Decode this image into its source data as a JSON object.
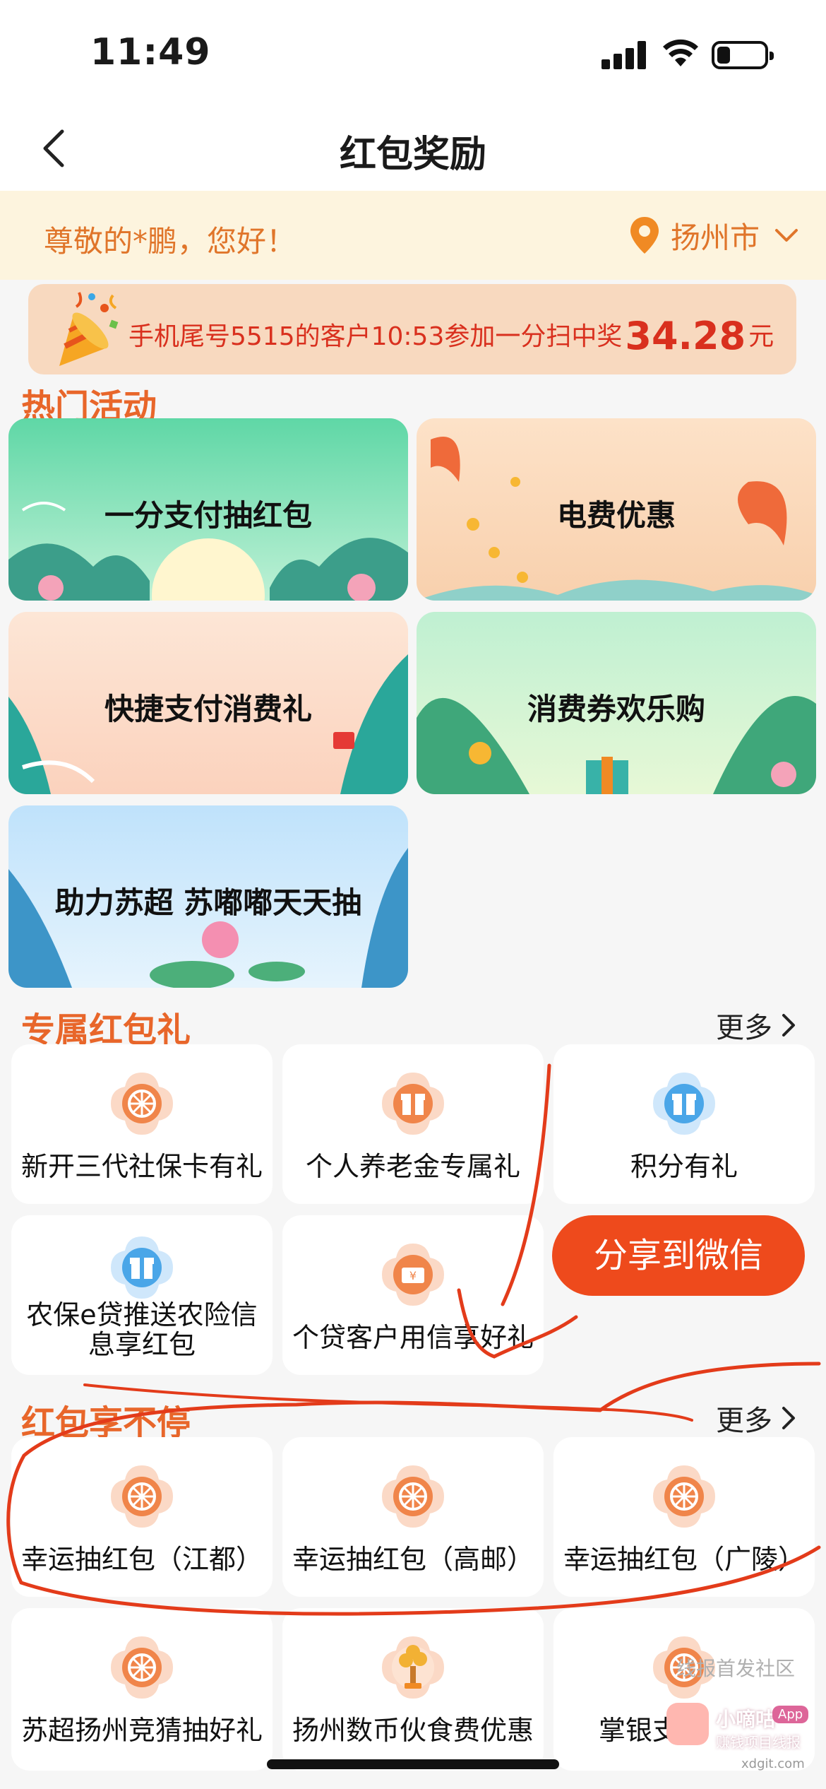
{
  "status_bar": {
    "time": "11:49"
  },
  "nav": {
    "title": "红包奖励"
  },
  "greeting": {
    "text": "尊敬的*鹏，您好！",
    "city": "扬州市"
  },
  "notice": {
    "text": "手机尾号5515的客户10:53参加一分扫中奖",
    "amount": "34.28",
    "unit": "元"
  },
  "hot_section": {
    "title": "热门活动",
    "items": [
      {
        "label": "一分支付抽红包"
      },
      {
        "label": "电费优惠"
      },
      {
        "label": "快捷支付消费礼"
      },
      {
        "label": "消费券欢乐购"
      },
      {
        "label": "助力苏超 苏嘟嘟天天抽"
      }
    ]
  },
  "exclusive_section": {
    "title": "专属红包礼",
    "more": "更多",
    "items": [
      {
        "label": "新开三代社保卡有礼",
        "icon": "gift-wheel-icon"
      },
      {
        "label": "个人养老金专属礼",
        "icon": "gift-box-icon"
      },
      {
        "label": "积分有礼",
        "icon": "blue-gift-icon"
      },
      {
        "label": "农保e贷推送农险信息享红包",
        "icon": "blue-gift-icon"
      },
      {
        "label": "个贷客户用信享好礼",
        "icon": "coupon-icon"
      }
    ]
  },
  "share": {
    "label": "分享到微信"
  },
  "nonstop_section": {
    "title": "红包享不停",
    "more": "更多",
    "items": [
      {
        "label": "幸运抽红包（江都）",
        "icon": "gift-wheel-icon"
      },
      {
        "label": "幸运抽红包（高邮）",
        "icon": "gift-wheel-icon"
      },
      {
        "label": "幸运抽红包（广陵）",
        "icon": "gift-wheel-icon"
      },
      {
        "label": "苏超扬州竞猜抽好礼",
        "icon": "gift-wheel-icon"
      },
      {
        "label": "扬州数币伙食费优惠",
        "icon": "money-tree-icon"
      },
      {
        "label": "掌银支",
        "icon": "gift-wheel-icon"
      }
    ]
  },
  "watermark": {
    "top": "线报首发社区",
    "app_name": "小嘀咕",
    "app_tag": "App",
    "app_sub": "赚钱项目线报",
    "site": "xdgit.com"
  },
  "colors": {
    "accent": "#e8662a",
    "notice_red": "#d9301e",
    "share_red": "#ee4a1c"
  }
}
